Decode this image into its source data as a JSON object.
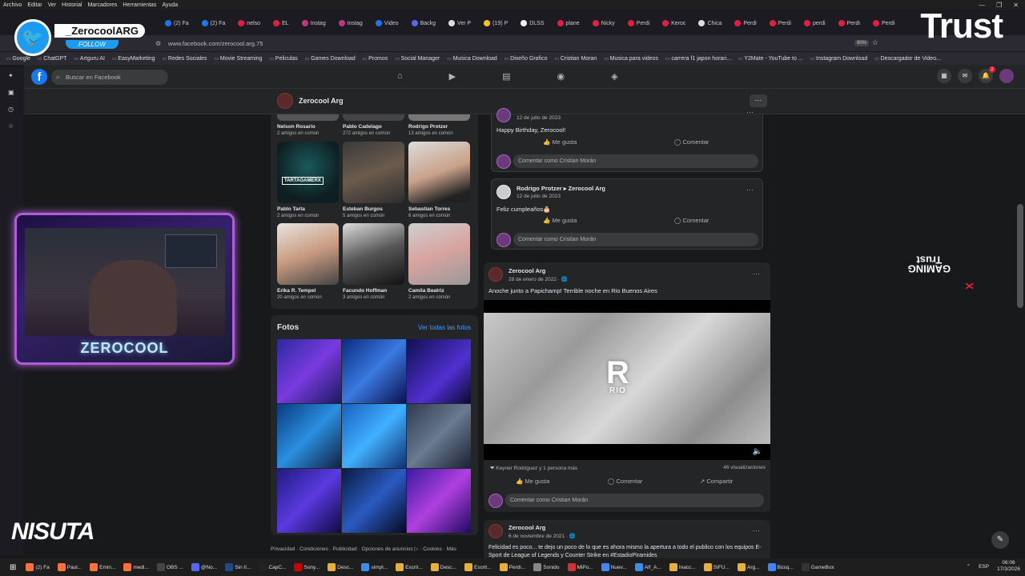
{
  "menu": [
    "Archivo",
    "Editar",
    "Ver",
    "Historial",
    "Marcadores",
    "Herramientas",
    "Ayuda"
  ],
  "tabs": [
    {
      "label": "(2) Fa",
      "color": "#1877f2"
    },
    {
      "label": "(2) Fa",
      "color": "#1877f2"
    },
    {
      "label": "nelso",
      "color": "#e41e3f"
    },
    {
      "label": "EL",
      "color": "#e41e3f"
    },
    {
      "label": "Instag",
      "color": "#c13584"
    },
    {
      "label": "Instag",
      "color": "#c13584"
    },
    {
      "label": "Video",
      "color": "#1877f2"
    },
    {
      "label": "Backg",
      "color": "#5865f2"
    },
    {
      "label": "Ver P",
      "color": "#ddd"
    },
    {
      "label": "(19) P",
      "color": "#f5c518"
    },
    {
      "label": "DLSS",
      "color": "#eee"
    },
    {
      "label": "plane",
      "color": "#e41e3f"
    },
    {
      "label": "Nicky",
      "color": "#e41e3f"
    },
    {
      "label": "Perdi",
      "color": "#e41e3f"
    },
    {
      "label": "Keroc",
      "color": "#e41e3f"
    },
    {
      "label": "Chica",
      "color": "#ddd"
    },
    {
      "label": "Perdi",
      "color": "#e41e3f"
    },
    {
      "label": "Perdi",
      "color": "#e41e3f"
    },
    {
      "label": "perdi",
      "color": "#e41e3f"
    },
    {
      "label": "Perdi",
      "color": "#e41e3f"
    },
    {
      "label": "Perdi",
      "color": "#e41e3f"
    }
  ],
  "address": {
    "url": "www.facebook.com/zerocool.arg.75",
    "zoom": "90%"
  },
  "bookmarks": [
    "Google",
    "ChatGPT",
    "Artguru AI",
    "EasyMarketing",
    "Redes Sociales",
    "Movie Streaming",
    "Peliculas",
    "Games Download",
    "Promos",
    "Social Manager",
    "Musica Download",
    "Diseño Grafico",
    "Cristian Moran",
    "Musica para videos",
    "carrera f1 japon horari...",
    "Y2Mate - YouTube to ...",
    "Instagram Download",
    "Descargador de Video..."
  ],
  "fb": {
    "search_placeholder": "Buscar en Facebook",
    "notif_count": "2",
    "page_name": "Zerocool Arg",
    "more": "···"
  },
  "friends_top": [
    {
      "name": "Nelson Rosario",
      "mutual": "2 amigos en común"
    },
    {
      "name": "Pablo Cadelago",
      "mutual": "272 amigos en común"
    },
    {
      "name": "Rodrigo Protzer",
      "mutual": "13 amigos en común"
    }
  ],
  "friends": [
    {
      "name": "Pablo Tarta",
      "mutual": "2 amigos en común",
      "photo_text": "TARTAGAMERX"
    },
    {
      "name": "Esteban Burgos",
      "mutual": "5 amigos en común"
    },
    {
      "name": "Sebastian Torres",
      "mutual": "6 amigos en común"
    },
    {
      "name": "Erika R. Tempel",
      "mutual": "20 amigos en común"
    },
    {
      "name": "Facundo Hoffman",
      "mutual": "3 amigos en común"
    },
    {
      "name": "Camila Beatriz",
      "mutual": "2 amigos en común"
    }
  ],
  "photos": {
    "title": "Fotos",
    "see_all": "Ver todas las fotos"
  },
  "footer": "Privacidad · Condiciones · Publicidad · Opciones de anuncios ▷ · Cookies · Más",
  "card1": {
    "date": "12 de julio de 2023",
    "text": "Happy Birthday, Zerocool!",
    "like": "Me gusta",
    "comment": "Comentar",
    "comment_placeholder": "Comentar como Cristian Morán"
  },
  "card2": {
    "author": "Rodrigo Protzer ▸ Zerocool Arg",
    "date": "12 de julio de 2023",
    "text": "Feliz cumpleaños🎂",
    "like": "Me gusta",
    "comment": "Comentar",
    "comment_placeholder": "Comentar como Cristian Morán"
  },
  "post1": {
    "author": "Zerocool Arg",
    "date": "28 de enero de 2022 · ",
    "text": "Anoche junto a Papichamp! Terrible noche en Rio Buenos Aires",
    "video_logo": "R",
    "video_sub": "RIO",
    "reactions": "Keyner Rodriguez y 1 persona más",
    "views": "46 visualizaciones",
    "like": "Me gusta",
    "comment": "Comentar",
    "share": "Compartir",
    "comment_placeholder": "Comentar como Cristian Morán"
  },
  "post2": {
    "author": "Zerocool Arg",
    "date": "6 de noviembre de 2021 · ",
    "text": "Felicidad es poco... te dejo un poco de lo que es ahora mismo la apertura a todo el publico con los equipos E-Sport de League of Legends y Counter Strike en #EstadioPiramides"
  },
  "overlay": {
    "twitter_handle": "_ZerocoolARG",
    "twitter_follow": "FOLLOW",
    "stream_name": "ZEROCOOL",
    "sponsor1": "Trust",
    "sponsor2": "NISUTA",
    "gaming_left": "GAMING",
    "gaming_x": "X",
    "gaming_right": "Trust"
  },
  "taskbar": [
    {
      "label": "(2) Fa",
      "color": "#ff7139"
    },
    {
      "label": "Paul...",
      "color": "#ff7139"
    },
    {
      "label": "Emin...",
      "color": "#ff7139"
    },
    {
      "label": "medi...",
      "color": "#ff7139"
    },
    {
      "label": "OBS ...",
      "color": "#444"
    },
    {
      "label": "@No...",
      "color": "#5865f2"
    },
    {
      "label": "Sin tí...",
      "color": "#1e4a8a"
    },
    {
      "label": "CapC...",
      "color": "#222"
    },
    {
      "label": "Sony...",
      "color": "#c00"
    },
    {
      "label": "Desc...",
      "color": "#e8b03a"
    },
    {
      "label": "simpl...",
      "color": "#3a8ee8"
    },
    {
      "label": "Escrit...",
      "color": "#e8b03a"
    },
    {
      "label": "Desc...",
      "color": "#e8b03a"
    },
    {
      "label": "Escrit...",
      "color": "#e8b03a"
    },
    {
      "label": "Perdi...",
      "color": "#e8b03a"
    },
    {
      "label": "Sonido",
      "color": "#888"
    },
    {
      "label": "MiPo...",
      "color": "#c33"
    },
    {
      "label": "Nuev...",
      "color": "#4285f4"
    },
    {
      "label": "Alf_A...",
      "color": "#3a8ee8"
    },
    {
      "label": "Inacc...",
      "color": "#e8b03a"
    },
    {
      "label": "SIFU...",
      "color": "#e8b03a"
    },
    {
      "label": "Arg...",
      "color": "#e8b03a"
    },
    {
      "label": "Búsq...",
      "color": "#4285f4"
    },
    {
      "label": "GameBox",
      "color": "#333"
    }
  ],
  "tray": {
    "lang": "ESP",
    "time": "06:06",
    "date": "17/3/2026"
  }
}
